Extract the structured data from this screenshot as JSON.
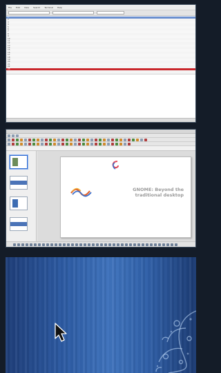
{
  "workspaces": {
    "ws1": {
      "menu": [
        "File",
        "Edit",
        "View",
        "Search",
        "Terminal",
        "Help"
      ],
      "rows": [
        {
          "n": "1",
          "a": "",
          "b": "",
          "hl": "blue"
        },
        {
          "n": "2",
          "a": "",
          "b": "",
          "hl": ""
        },
        {
          "n": "3",
          "a": "",
          "b": "",
          "hl": ""
        },
        {
          "n": "4",
          "a": "",
          "b": "",
          "hl": ""
        },
        {
          "n": "5",
          "a": "",
          "b": "",
          "hl": ""
        },
        {
          "n": "6",
          "a": "",
          "b": "",
          "hl": ""
        },
        {
          "n": "7",
          "a": "",
          "b": "",
          "hl": ""
        },
        {
          "n": "8",
          "a": "",
          "b": "",
          "hl": ""
        },
        {
          "n": "9",
          "a": "",
          "b": "",
          "hl": ""
        },
        {
          "n": "10",
          "a": "",
          "b": "",
          "hl": ""
        },
        {
          "n": "11",
          "a": "",
          "b": "",
          "hl": ""
        },
        {
          "n": "12",
          "a": "",
          "b": "",
          "hl": ""
        },
        {
          "n": "13",
          "a": "",
          "b": "",
          "hl": ""
        },
        {
          "n": "14",
          "a": "",
          "b": "",
          "hl": ""
        },
        {
          "n": "15",
          "a": "",
          "b": "",
          "hl": ""
        },
        {
          "n": "16",
          "a": "",
          "b": "",
          "hl": ""
        },
        {
          "n": "17",
          "a": "",
          "b": "",
          "hl": ""
        },
        {
          "n": "18",
          "a": "",
          "b": "",
          "hl": ""
        },
        {
          "n": "19",
          "a": "",
          "b": "",
          "hl": ""
        },
        {
          "n": "20",
          "a": "",
          "b": "",
          "hl": ""
        },
        {
          "n": "21",
          "a": "",
          "b": "",
          "hl": ""
        },
        {
          "n": "22",
          "a": "",
          "b": "",
          "hl": ""
        },
        {
          "n": "23",
          "a": "",
          "b": "",
          "hl": "red"
        }
      ]
    },
    "ws2": {
      "slide_title": "GNOME: Beyond the traditional desktop",
      "slide_subtitle": "",
      "slide_logo": "",
      "slide_footer": "",
      "thumb_labels": [
        "",
        "",
        "",
        ""
      ]
    },
    "ws3": {
      "cursor": "pointer-arrow-icon"
    }
  },
  "colors": {
    "background": "#141c28",
    "row_highlight_blue": "#6a8fcf",
    "row_highlight_red": "#c9262b",
    "slide_title_gray": "#9a9a9a",
    "slide_subtitle_orange": "#e89a3a",
    "wallpaper_blue": "#2c5aa2"
  }
}
